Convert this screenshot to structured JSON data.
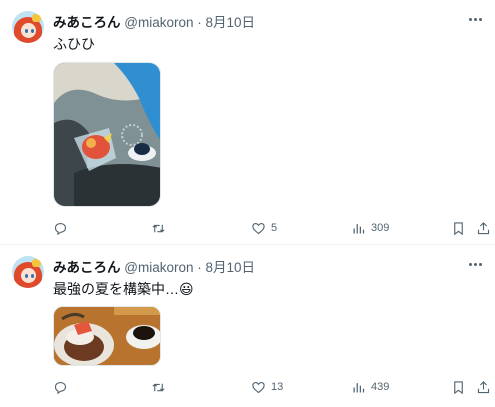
{
  "posts": [
    {
      "author": "みあころん",
      "handle": "@miakoron",
      "separator": "·",
      "date": "8月10日",
      "text": "ふひひ",
      "image_alt": "acrylic keychain charm on fabric",
      "stats": {
        "replies": "",
        "retweets": "",
        "likes": "5",
        "views": "309"
      }
    },
    {
      "author": "みあころん",
      "handle": "@miakoron",
      "separator": "·",
      "date": "8月10日",
      "text": "最強の夏を構築中…😃",
      "image_alt": "dessert and coffee on cafe table",
      "stats": {
        "replies": "",
        "retweets": "",
        "likes": "13",
        "views": "439"
      }
    }
  ],
  "icons": {
    "reply": "reply-icon",
    "retweet": "retweet-icon",
    "like": "heart-icon",
    "views": "views-icon",
    "bookmark": "bookmark-icon",
    "share": "share-icon",
    "more": "more-icon"
  },
  "colors": {
    "secondary_text": "#536471",
    "primary_text": "#0f1419",
    "divider": "#eff3f4"
  }
}
